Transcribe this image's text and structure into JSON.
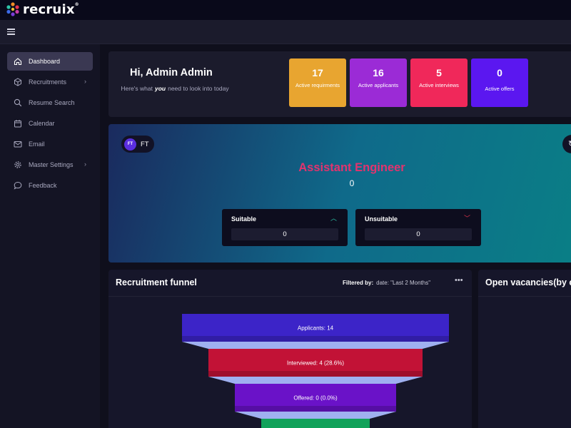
{
  "brand": {
    "name": "recruix",
    "mark": "®"
  },
  "sidebar": {
    "items": [
      {
        "label": "Dashboard",
        "icon": "home-icon",
        "active": true
      },
      {
        "label": "Recruitments",
        "icon": "cube-icon",
        "chevron": "›"
      },
      {
        "label": "Resume Search",
        "icon": "search-icon"
      },
      {
        "label": "Calendar",
        "icon": "calendar-icon"
      },
      {
        "label": "Email",
        "icon": "mail-icon"
      },
      {
        "label": "Master Settings",
        "icon": "gear-icon",
        "chevron": "›"
      },
      {
        "label": "Feedback",
        "icon": "chat-bubble-icon"
      }
    ]
  },
  "greeting": {
    "title": "Hi, Admin Admin",
    "sub_before": "Here's what",
    "sub_em": "you",
    "sub_after": "need to look into today"
  },
  "stats": [
    {
      "value": "17",
      "label": "Active requirments",
      "color": "#e8a530"
    },
    {
      "value": "16",
      "label": "Active applicants",
      "color": "#9b2bd6"
    },
    {
      "value": "5",
      "label": "Active interviews",
      "color": "#f0285a"
    },
    {
      "value": "0",
      "label": "Active offers",
      "color": "#5b17f0"
    }
  ],
  "job": {
    "chip_initials": "FT",
    "chip_label": "FT",
    "title": "Assistant Engineer",
    "count": "0",
    "suitable": {
      "label": "Suitable",
      "value": "0",
      "arrow": "︿",
      "arrow_color": "#2ec4a8"
    },
    "unsuitable": {
      "label": "Unsuitable",
      "value": "0",
      "arrow": "﹀",
      "arrow_color": "#e8344f"
    }
  },
  "funnel": {
    "title": "Recruitment funnel",
    "filter_label": "Filtered by:",
    "filter_value": "date: \"Last 2 Months\"",
    "menu": "•••",
    "chart_data": {
      "type": "funnel",
      "stages": [
        {
          "label": "Applicants: 14",
          "value": 14,
          "color": "#3c24c8"
        },
        {
          "label": "Interviewed: 4 (28.6%)",
          "value": 4,
          "color": "#c21236"
        },
        {
          "label": "Offered: 0 (0.0%)",
          "value": 0,
          "color": "#6a12c8"
        },
        {
          "label": "",
          "value": 0,
          "color": "#11a25a"
        }
      ]
    }
  },
  "vacancies": {
    "title": "Open vacancies(by c"
  }
}
